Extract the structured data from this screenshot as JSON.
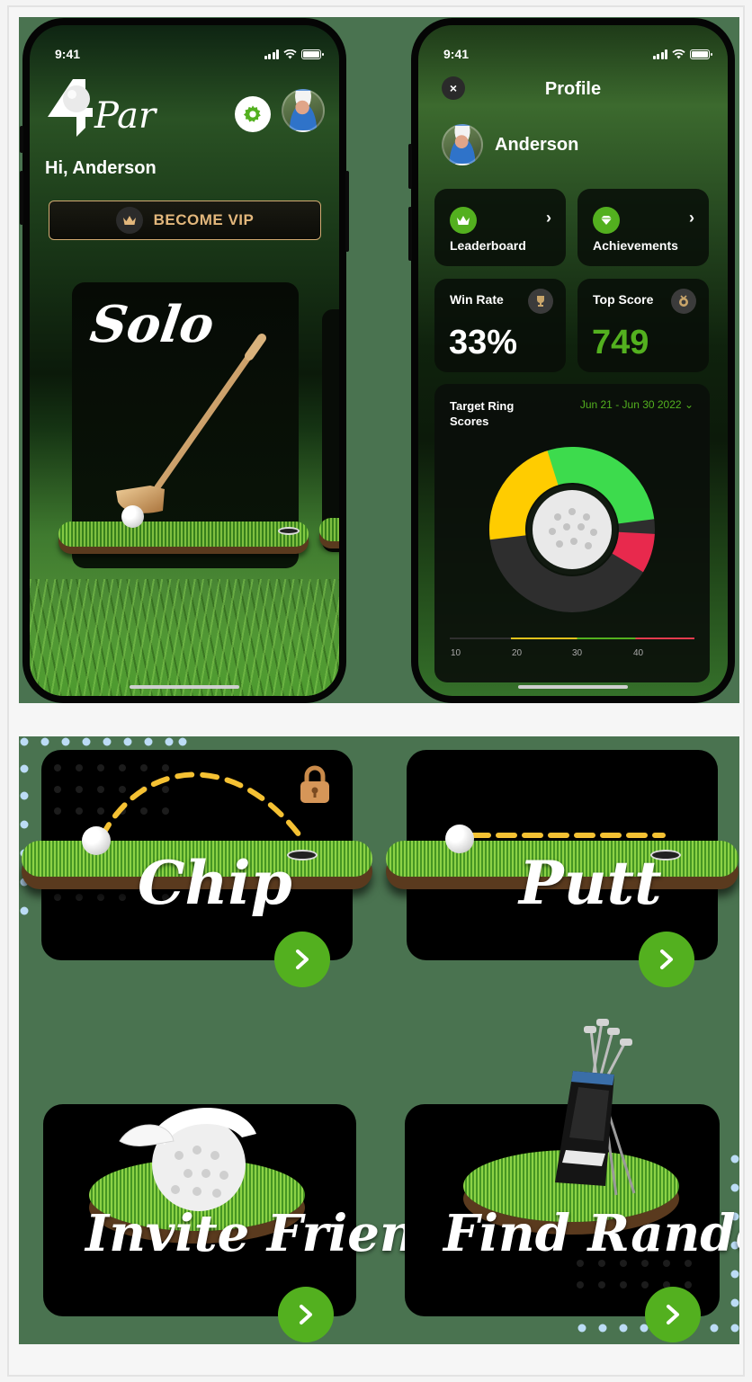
{
  "status_bar": {
    "time": "9:41"
  },
  "home_screen": {
    "logo_text": "Par",
    "greeting": "Hi, Anderson",
    "vip_button": "BECOME VIP",
    "mode_card_title": "Solo"
  },
  "profile_screen": {
    "title": "Profile",
    "close_icon": "×",
    "user_name": "Anderson",
    "links": [
      {
        "label": "Leaderboard",
        "icon": "crown-icon"
      },
      {
        "label": "Achievements",
        "icon": "diamond-icon"
      }
    ],
    "stats": [
      {
        "label": "Win Rate",
        "value": "33%",
        "icon": "trophy-icon",
        "value_color": "#ffffff"
      },
      {
        "label": "Top Score",
        "value": "749",
        "icon": "medal-icon",
        "value_color": "#53b01f"
      }
    ],
    "target_ring": {
      "title": "Target Ring Scores",
      "date_range": "Jun 21 - Jun 30 2022",
      "date_chevron": "⌄",
      "axis_ticks": [
        "10",
        "20",
        "30",
        "40"
      ],
      "segment_colors": {
        "green": "#3ddb4d",
        "red": "#e8294d",
        "dark": "#2e2e2e",
        "yellow": "#ffcc00"
      }
    }
  },
  "game_modes": [
    {
      "title": "Chip",
      "locked": true
    },
    {
      "title": "Putt",
      "locked": false
    },
    {
      "title": "Invite Friends",
      "locked": false
    },
    {
      "title": "Find Random",
      "locked": false
    }
  ],
  "colors": {
    "accent_green": "#53b01f",
    "vip_gold": "#e3b77c",
    "panel_green": "#4a7350",
    "dot_blue": "#bcdcf6"
  }
}
